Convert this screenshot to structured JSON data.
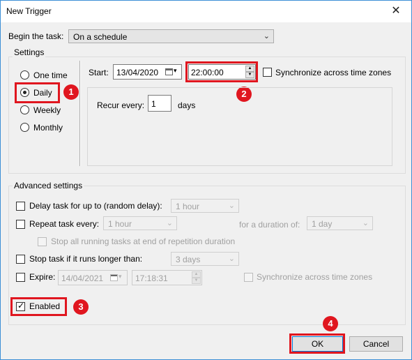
{
  "window": {
    "title": "New Trigger",
    "close_glyph": "✕"
  },
  "begin_task": {
    "label": "Begin the task:",
    "value": "On a schedule"
  },
  "settings": {
    "group_label": "Settings",
    "options": [
      {
        "label": "One time",
        "selected": false
      },
      {
        "label": "Daily",
        "selected": true
      },
      {
        "label": "Weekly",
        "selected": false
      },
      {
        "label": "Monthly",
        "selected": false
      }
    ],
    "start_label": "Start:",
    "start_date": "13/04/2020",
    "start_time": "22:00:00",
    "sync_label": "Synchronize across time zones",
    "recur_label": "Recur every:",
    "recur_value": "1",
    "recur_unit": "days"
  },
  "advanced": {
    "group_label": "Advanced settings",
    "delay_label": "Delay task for up to (random delay):",
    "delay_value": "1 hour",
    "repeat_label": "Repeat task every:",
    "repeat_value": "1 hour",
    "duration_label": "for a duration of:",
    "duration_value": "1 day",
    "stop_running_label": "Stop all running tasks at end of repetition duration",
    "stop_longer_label": "Stop task if it runs longer than:",
    "stop_longer_value": "3 days",
    "expire_label": "Expire:",
    "expire_date": "14/04/2021",
    "expire_time": "17:18:31",
    "expire_sync_label": "Synchronize across time zones",
    "enabled_label": "Enabled",
    "enabled_checked": true
  },
  "buttons": {
    "ok": "OK",
    "cancel": "Cancel"
  },
  "annotations": {
    "badge1": "1",
    "badge2": "2",
    "badge3": "3",
    "badge4": "4"
  },
  "colors": {
    "highlight": "#e0161f",
    "window_border": "#3c8fd6"
  }
}
